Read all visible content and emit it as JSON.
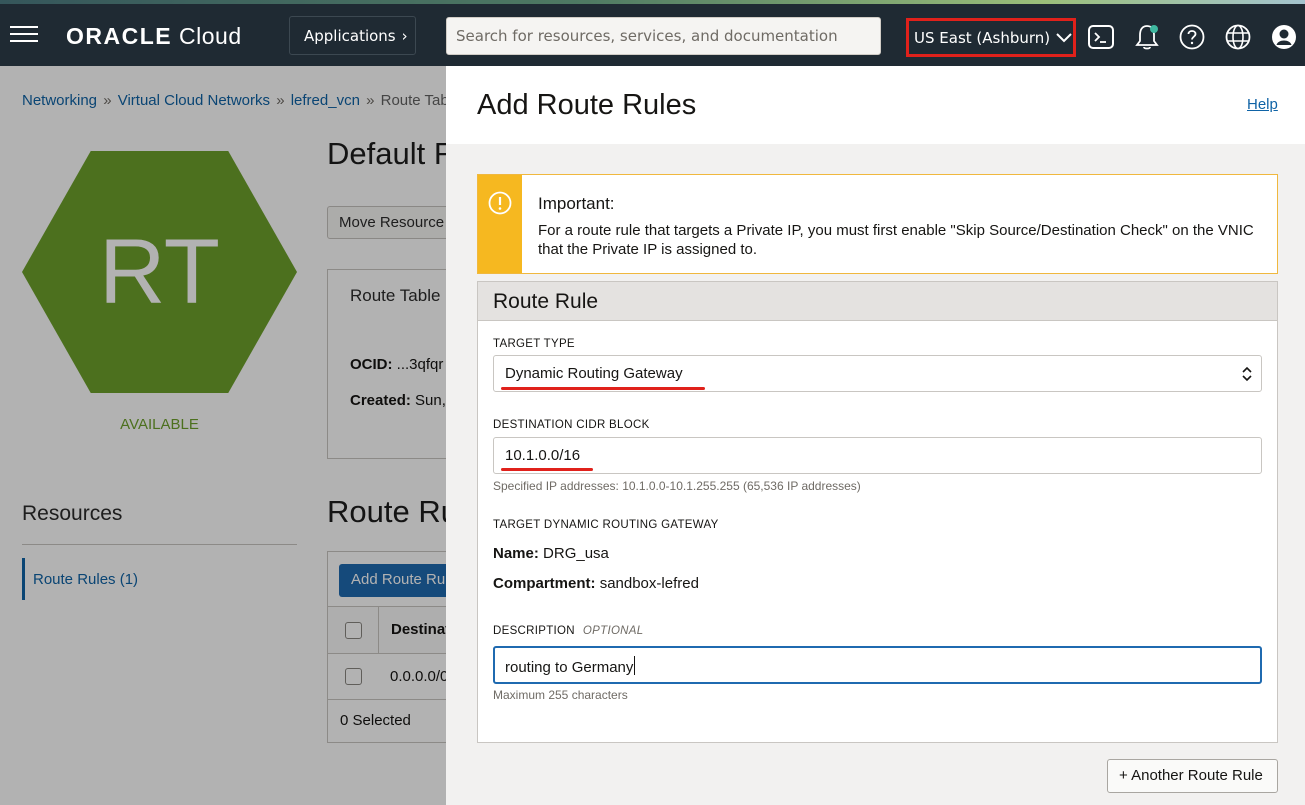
{
  "header": {
    "logo_brand": "ORACLE",
    "logo_product": "Cloud",
    "applications_label": "Applications",
    "search_placeholder": "Search for resources, services, and documentation",
    "region": "US East (Ashburn)",
    "icons": [
      "menu-icon",
      "cloud-shell-icon",
      "bell-icon",
      "help-icon",
      "globe-icon",
      "user-icon"
    ],
    "accent_stripe": "#4f7a63"
  },
  "page": {
    "breadcrumb": [
      "Networking",
      "Virtual Cloud Networks",
      "lefred_vcn",
      "Route Tab"
    ],
    "breadcrumb_sep": "»",
    "hex_text": "RT",
    "hex_color": "#6ea12c",
    "status": "AVAILABLE",
    "title": "Default R",
    "move_resource": "Move Resource",
    "info_title": "Route Table",
    "ocid_label": "OCID:",
    "ocid_value": "...3qfqr",
    "created_label": "Created:",
    "created_value": "Sun,",
    "resources_title": "Resources",
    "resources_item": "Route Rules (1)",
    "rules_title": "Route Ru",
    "add_rule_button": "Add Route Ru",
    "col_destination": "Destinat",
    "row_destination": "0.0.0.0/0",
    "selected": "0 Selected"
  },
  "panel": {
    "title": "Add Route Rules",
    "help": "Help",
    "alert": {
      "title": "Important:",
      "text": "For a route rule that targets a Private IP, you must first enable \"Skip Source/Destination Check\" on the VNIC that the Private IP is assigned to.",
      "color": "#f6b820"
    },
    "rule": {
      "heading": "Route Rule",
      "target_type_label": "TARGET TYPE",
      "target_type_value": "Dynamic Routing Gateway",
      "cidr_label": "DESTINATION CIDR BLOCK",
      "cidr_value": "10.1.0.0/16",
      "cidr_hint": "Specified IP addresses: 10.1.0.0-10.1.255.255 (65,536 IP addresses)",
      "drg_label": "TARGET DYNAMIC ROUTING GATEWAY",
      "name_label": "Name:",
      "name_value": "DRG_usa",
      "compartment_label": "Compartment:",
      "compartment_value": "sandbox-lefred",
      "description_label": "DESCRIPTION",
      "description_optional": "OPTIONAL",
      "description_value": "routing to Germany",
      "description_hint": "Maximum 255 characters"
    },
    "another_rule_button": "+ Another Route Rule",
    "annotation_color": "#e0211b"
  }
}
